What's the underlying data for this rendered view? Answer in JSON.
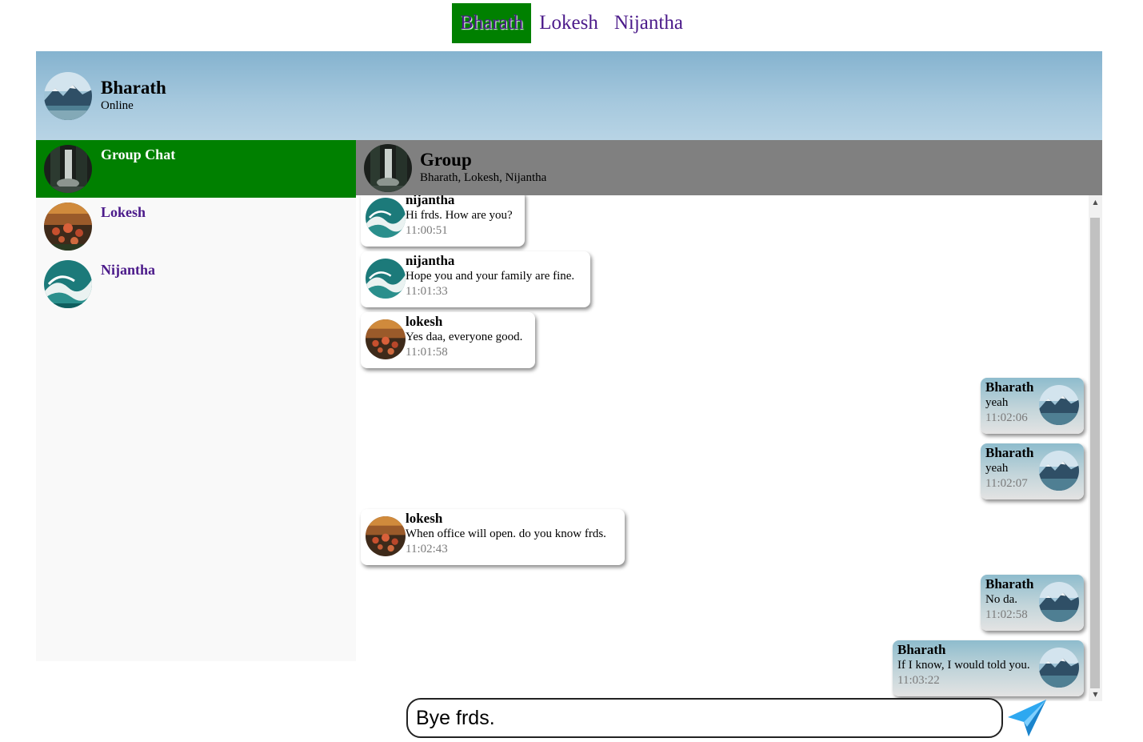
{
  "colors": {
    "active_green": "#008000",
    "link_purple": "#4b1a8a",
    "chat_header_gray": "#808080",
    "sidebar_bg": "#f9f9f9"
  },
  "topnav": {
    "users": [
      "Bharath",
      "Lokesh",
      "Nijantha"
    ],
    "active": "Bharath"
  },
  "profile": {
    "name": "Bharath",
    "status": "Online",
    "avatar_icon": "mountain-landscape-icon"
  },
  "sidebar": {
    "contacts": [
      {
        "name": "Group Chat",
        "active": true,
        "avatar_icon": "waterfall-icon"
      },
      {
        "name": "Lokesh",
        "active": false,
        "avatar_icon": "flowers-icon"
      },
      {
        "name": "Nijantha",
        "active": false,
        "avatar_icon": "ocean-wave-icon"
      }
    ]
  },
  "chat": {
    "title": "Group",
    "members": "Bharath, Lokesh, Nijantha",
    "messages": [
      {
        "sender": "nijantha",
        "text": "Hi frds. How are you?",
        "time": "11:00:51",
        "mine": false
      },
      {
        "sender": "nijantha",
        "text": "Hope you and your family are fine.",
        "time": "11:01:33",
        "mine": false
      },
      {
        "sender": "lokesh",
        "text": "Yes daa, everyone good.",
        "time": "11:01:58",
        "mine": false
      },
      {
        "sender": "Bharath",
        "text": "yeah",
        "time": "11:02:06",
        "mine": true
      },
      {
        "sender": "Bharath",
        "text": "yeah",
        "time": "11:02:07",
        "mine": true
      },
      {
        "sender": "lokesh",
        "text": "When office will open. do you know frds.",
        "time": "11:02:43",
        "mine": false
      },
      {
        "sender": "Bharath",
        "text": "No da.",
        "time": "11:02:58",
        "mine": true
      },
      {
        "sender": "Bharath",
        "text": "If I know, I would told you.",
        "time": "11:03:22",
        "mine": true
      }
    ]
  },
  "composer": {
    "value": "Bye frds.",
    "send_icon": "paper-plane-icon"
  }
}
